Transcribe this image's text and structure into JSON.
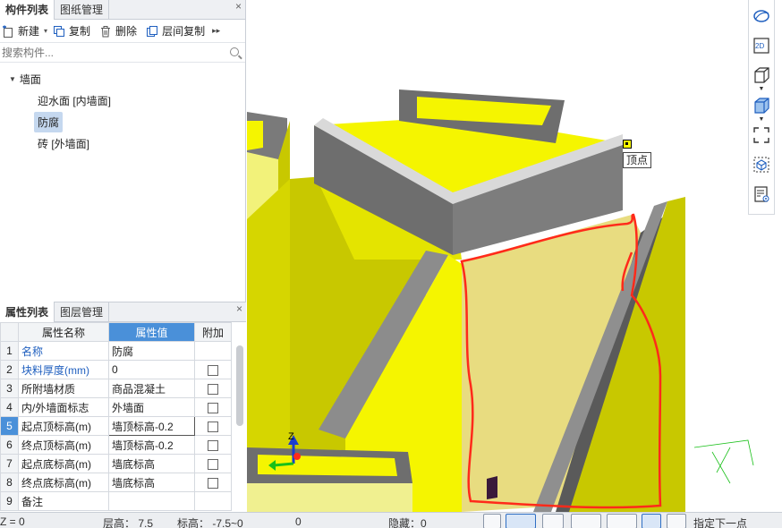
{
  "component_panel": {
    "tabs": [
      {
        "label": "构件列表",
        "active": true
      },
      {
        "label": "图纸管理",
        "active": false
      }
    ],
    "close_glyph": "×",
    "toolbar": {
      "new_label": "新建",
      "copy_label": "复制",
      "delete_label": "删除",
      "floor_copy_label": "层间复制",
      "more_glyph": "▸▸"
    },
    "search": {
      "placeholder": "搜索构件..."
    },
    "tree": {
      "root": {
        "label": "墙面",
        "expanded": true
      },
      "children": [
        {
          "label": "迎水面 [内墙面]",
          "selected": false
        },
        {
          "label": "防腐",
          "selected": true
        },
        {
          "label": "砖 [外墙面]",
          "selected": false
        }
      ]
    }
  },
  "property_panel": {
    "tabs": [
      {
        "label": "属性列表",
        "active": true
      },
      {
        "label": "图层管理",
        "active": false
      }
    ],
    "close_glyph": "×",
    "columns": [
      "属性名称",
      "属性值",
      "附加"
    ],
    "rows": [
      {
        "num": "1",
        "name": "名称",
        "value": "防腐",
        "blue": true,
        "has_check": false
      },
      {
        "num": "2",
        "name": "块料厚度(mm)",
        "value": "0",
        "blue": true,
        "has_check": true
      },
      {
        "num": "3",
        "name": "所附墙材质",
        "value": "商品混凝土",
        "blue": false,
        "has_check": true
      },
      {
        "num": "4",
        "name": "内/外墙面标志",
        "value": "外墙面",
        "blue": false,
        "has_check": true
      },
      {
        "num": "5",
        "name": "起点顶标高(m)",
        "value": "墙顶标高-0.2",
        "blue": false,
        "has_check": true,
        "editing": true
      },
      {
        "num": "6",
        "name": "终点顶标高(m)",
        "value": "墙顶标高-0.2",
        "blue": false,
        "has_check": true
      },
      {
        "num": "7",
        "name": "起点底标高(m)",
        "value": "墙底标高",
        "blue": false,
        "has_check": true
      },
      {
        "num": "8",
        "name": "终点底标高(m)",
        "value": "墙底标高",
        "blue": false,
        "has_check": true
      },
      {
        "num": "9",
        "name": "备注",
        "value": "",
        "blue": false,
        "has_check": false
      }
    ]
  },
  "viewport": {
    "tooltip": "顶点",
    "axis_label": "Z",
    "colors": {
      "wall_yellow": "#f5f500",
      "wall_dark_yellow": "#c8c800",
      "top_gray": "#7a7a7a",
      "cap_light": "#d9d9d9",
      "pale_face": "#e8dc80",
      "annotation_red": "#ff2a1a",
      "gizmo_blue": "#1a3ccf",
      "gizmo_green": "#19c019"
    }
  },
  "right_toolbar": {
    "icons": [
      "orbit-icon",
      "view-2d-icon",
      "view-3d-box-icon",
      "view-3d-solid-icon",
      "fullscreen-icon",
      "section-box-icon",
      "display-settings-icon"
    ],
    "label_2d": "2D"
  },
  "status_bar": {
    "z": "Z = 0",
    "floor_height": "层高： 7.5",
    "elevation": "标高： -7.5~0",
    "count": "0",
    "hidden": "隐藏：0",
    "prompt": "指定下一点"
  }
}
